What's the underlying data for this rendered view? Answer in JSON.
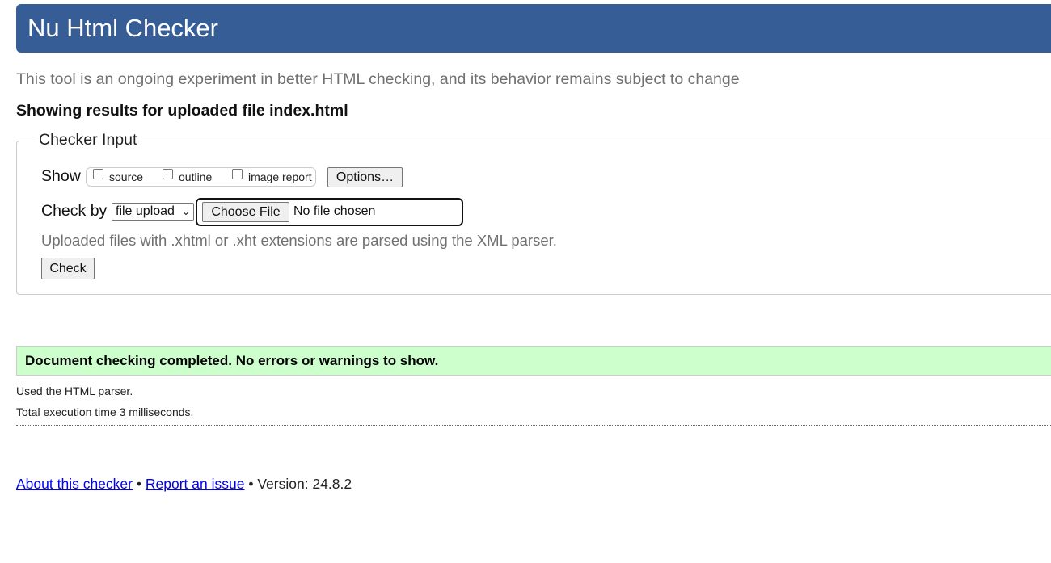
{
  "header": {
    "title": "Nu Html Checker"
  },
  "tagline": "This tool is an ongoing experiment in better HTML checking, and its behavior remains subject to change",
  "results_heading": "Showing results for uploaded file index.html",
  "checker_input": {
    "legend": "Checker Input",
    "show_label": "Show",
    "show_options": [
      {
        "label": "source",
        "checked": false
      },
      {
        "label": "outline",
        "checked": false
      },
      {
        "label": "image report",
        "checked": false
      }
    ],
    "options_button": "Options…",
    "check_by_label": "Check by",
    "check_by_value": "file upload",
    "choose_file_button": "Choose File",
    "file_status": "No file chosen",
    "hint": "Uploaded files with .xhtml or .xht extensions are parsed using the XML parser.",
    "check_button": "Check"
  },
  "result": {
    "message": "Document checking completed. No errors or warnings to show.",
    "parser_note": "Used the HTML parser.",
    "execution_time": "Total execution time 3 milliseconds."
  },
  "footer": {
    "about_link": "About this checker",
    "separator": "•",
    "report_link": "Report an issue",
    "version": "Version: 24.8.2"
  },
  "colors": {
    "header_bg": "#365d95",
    "success_bg": "#ccffcc",
    "link": "#0000ee"
  }
}
